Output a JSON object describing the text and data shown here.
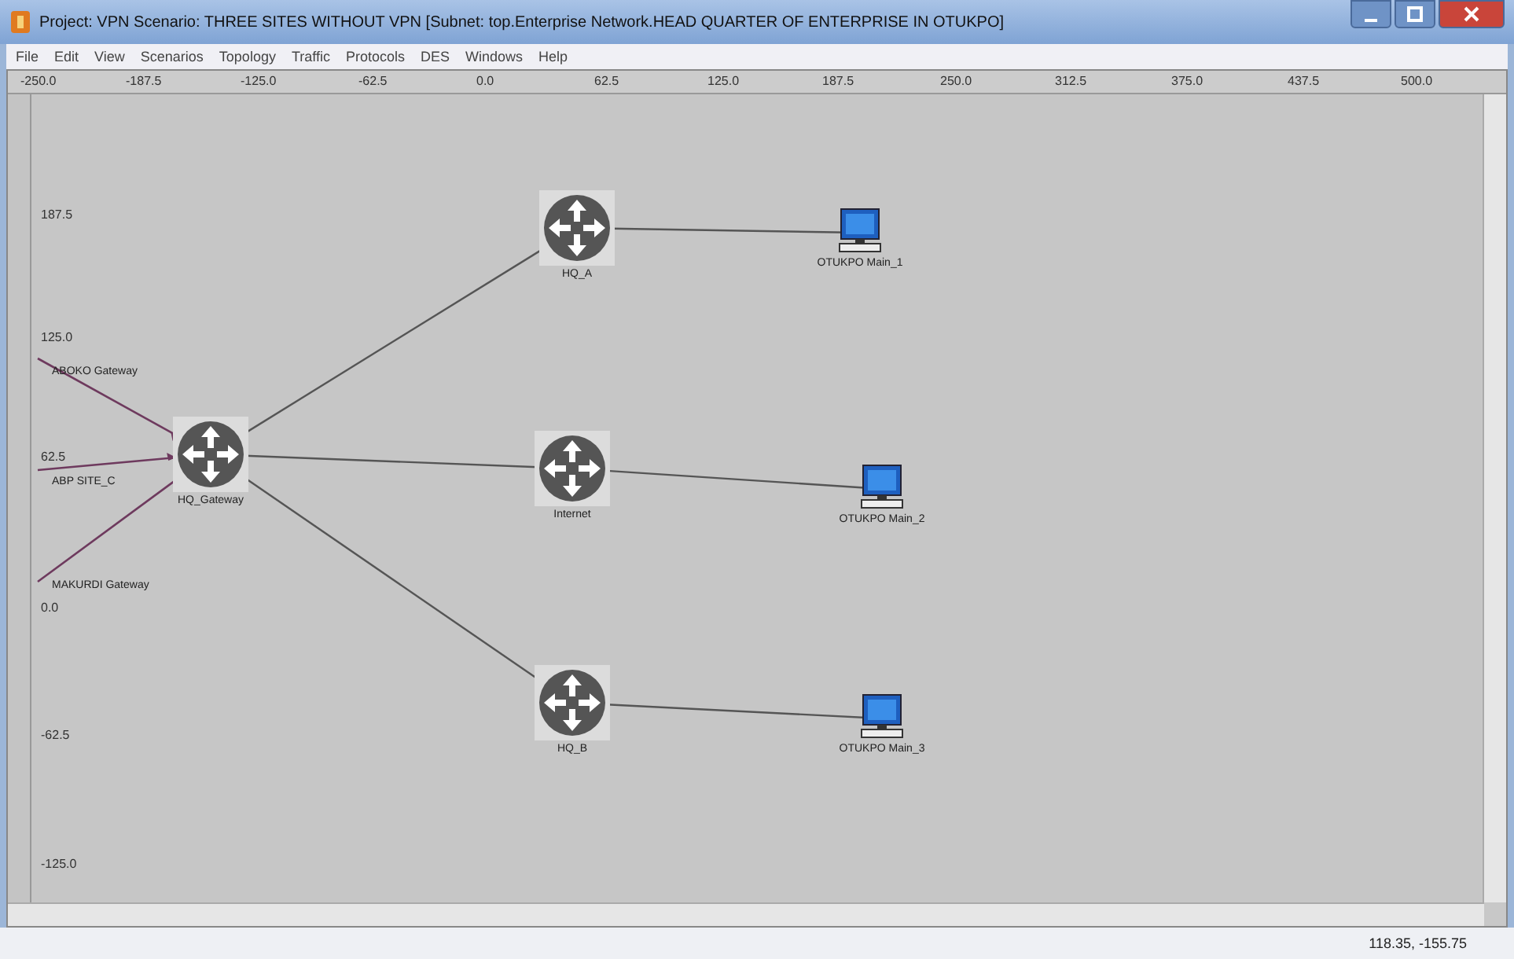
{
  "window": {
    "title": "Project: VPN Scenario: THREE SITES WITHOUT VPN  [Subnet: top.Enterprise Network.HEAD QUARTER OF ENTERPRISE IN OTUKPO]"
  },
  "menu": [
    "File",
    "Edit",
    "View",
    "Scenarios",
    "Topology",
    "Traffic",
    "Protocols",
    "DES",
    "Windows",
    "Help"
  ],
  "x_ruler": [
    "-250.0",
    "-187.5",
    "-125.0",
    "-62.5",
    "0.0",
    "62.5",
    "125.0",
    "187.5",
    "250.0",
    "312.5",
    "375.0",
    "437.5",
    "500.0"
  ],
  "y_ruler": [
    "187.5",
    "125.0",
    "62.5",
    "0.0",
    "-62.5",
    "-125.0"
  ],
  "nodes": [
    {
      "kind": "router",
      "label": "HQ_Gateway"
    },
    {
      "kind": "router",
      "label": "HQ_A"
    },
    {
      "kind": "router",
      "label": "Internet"
    },
    {
      "kind": "router",
      "label": "HQ_B"
    },
    {
      "kind": "pc",
      "label": "OTUKPO Main_1"
    },
    {
      "kind": "pc",
      "label": "OTUKPO Main_2"
    },
    {
      "kind": "pc",
      "label": "OTUKPO Main_3"
    },
    {
      "kind": "site",
      "label": "ABOKO Gateway"
    },
    {
      "kind": "site",
      "label": "ABP SITE_C"
    },
    {
      "kind": "site",
      "label": "MAKURDI Gateway"
    }
  ],
  "status_bar": {
    "coordinates": "118.35, -155.75"
  }
}
